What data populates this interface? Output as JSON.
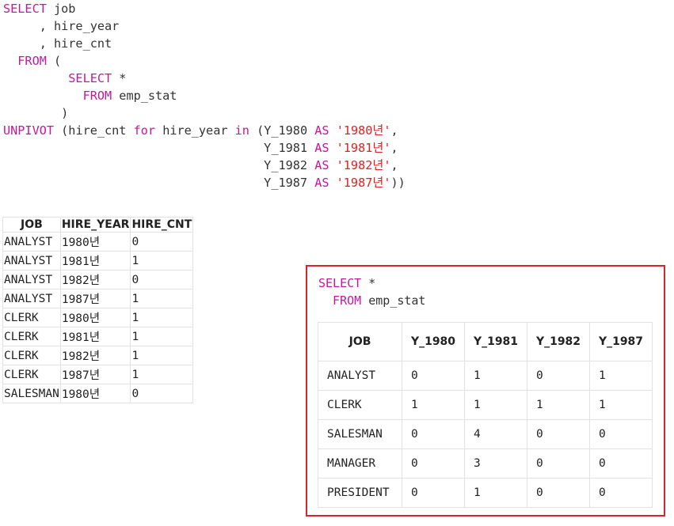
{
  "query1": {
    "line1": [
      "SELECT",
      " job"
    ],
    "line2": "     , hire_year",
    "line3": "     , hire_cnt",
    "line4": [
      "  FROM",
      " ("
    ],
    "line5": [
      "         SELECT",
      " *"
    ],
    "line6": [
      "           FROM",
      " emp_stat"
    ],
    "line7": "        )",
    "unpivot": [
      "UNPIVOT",
      " (hire_cnt ",
      "for",
      " hire_year ",
      "in",
      " (Y_1980 ",
      "AS",
      "'1980년'",
      ","
    ],
    "row2": [
      "                                    Y_1981 ",
      "AS",
      "'1981년'",
      ","
    ],
    "row3": [
      "                                    Y_1982 ",
      "AS",
      "'1982년'",
      ","
    ],
    "row4": [
      "                                    Y_1987 ",
      "AS",
      "'1987년'",
      "))"
    ]
  },
  "result1": {
    "headers": [
      "JOB",
      "HIRE_YEAR",
      "HIRE_CNT"
    ],
    "rows": [
      [
        "ANALYST",
        "1980년",
        "0"
      ],
      [
        "ANALYST",
        "1981년",
        "1"
      ],
      [
        "ANALYST",
        "1982년",
        "0"
      ],
      [
        "ANALYST",
        "1987년",
        "1"
      ],
      [
        "CLERK",
        "1980년",
        "1"
      ],
      [
        "CLERK",
        "1981년",
        "1"
      ],
      [
        "CLERK",
        "1982년",
        "1"
      ],
      [
        "CLERK",
        "1987년",
        "1"
      ],
      [
        "SALESMAN",
        "1980년",
        "0"
      ]
    ]
  },
  "query2": {
    "line1": [
      "SELECT",
      " *"
    ],
    "line2": [
      "  FROM",
      " emp_stat"
    ]
  },
  "result2": {
    "headers": [
      "JOB",
      "Y_1980",
      "Y_1981",
      "Y_1982",
      "Y_1987"
    ],
    "rows": [
      [
        "ANALYST",
        "0",
        "1",
        "0",
        "1"
      ],
      [
        "CLERK",
        "1",
        "1",
        "1",
        "1"
      ],
      [
        "SALESMAN",
        "0",
        "4",
        "0",
        "0"
      ],
      [
        "MANAGER",
        "0",
        "3",
        "0",
        "0"
      ],
      [
        "PRESIDENT",
        "0",
        "1",
        "0",
        "0"
      ]
    ]
  },
  "colors": {
    "keyword": "#c0199b",
    "string": "#dd2222",
    "highlight_border": "#d9232e"
  }
}
